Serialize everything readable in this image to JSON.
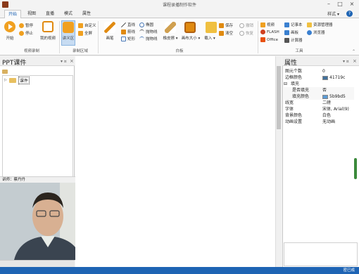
{
  "window": {
    "title": "课程录播制作软件"
  },
  "tabs": [
    {
      "label": "开始",
      "active": true
    },
    {
      "label": "视图",
      "active": false
    },
    {
      "label": "直播",
      "active": false
    },
    {
      "label": "模式",
      "active": false
    },
    {
      "label": "属性",
      "active": false
    }
  ],
  "style_menu": {
    "label": "样式"
  },
  "ribbon": {
    "video_group": {
      "label": "视频录制",
      "start": "开始",
      "pause": "暂停",
      "stop": "停止",
      "my_video": "我的视频"
    },
    "area_group": {
      "label": "录制区域",
      "lecture": "讲义区",
      "custom": "自定义",
      "fullscreen": "全屏"
    },
    "board_group": {
      "label": "白板",
      "pen": "画笔",
      "line": "直线",
      "ellipse": "椭圆",
      "straight_arrow": "箭线",
      "curve_arrow": "抛物线",
      "rect": "矩形",
      "curve": "抛物线",
      "eraser": "橡皮擦",
      "canvas_size": "画布大小",
      "import": "载入",
      "save": "保存",
      "clear": "清空",
      "undo": "撤销",
      "redo": "恢复"
    },
    "tools_group": {
      "label": "工具",
      "video": "视频",
      "flash": "FLASH",
      "office": "Office",
      "notepad": "记事本",
      "paint": "画板",
      "calculator": "计算器",
      "explorer": "资源管理器",
      "browser": "浏览器"
    }
  },
  "left_pane": {
    "title": "PPT课件",
    "tree_item": "课件",
    "lecturer": "讲师：蔡丹丹"
  },
  "right_pane": {
    "title": "属性",
    "rows": [
      {
        "key": "图元个数",
        "value": "0",
        "indent": 0,
        "swatch": ""
      },
      {
        "key": "边框颜色",
        "value": "41719c",
        "indent": 0,
        "swatch": "#41719c"
      },
      {
        "key": "填充",
        "value": "",
        "indent": 0,
        "swatch": "",
        "group": true
      },
      {
        "key": "是否填充",
        "value": "否",
        "indent": 1,
        "swatch": ""
      },
      {
        "key": "填充颜色",
        "value": "5b9bd5",
        "indent": 1,
        "swatch": "#5b9bd5"
      },
      {
        "key": "线宽",
        "value": "二磅",
        "indent": 0,
        "swatch": ""
      },
      {
        "key": "字体",
        "value": "宋体, Arial(9)",
        "indent": 0,
        "swatch": ""
      },
      {
        "key": "背景颜色",
        "value": "白色",
        "indent": 0,
        "swatch": ""
      },
      {
        "key": "动画设置",
        "value": "无动画",
        "indent": 0,
        "swatch": ""
      }
    ]
  },
  "status_bar": {
    "right": "密已成"
  },
  "colors": {
    "accent": "#1e64b4",
    "tab_active_text": "#1e64b4",
    "video_orange": "#f0a020"
  }
}
